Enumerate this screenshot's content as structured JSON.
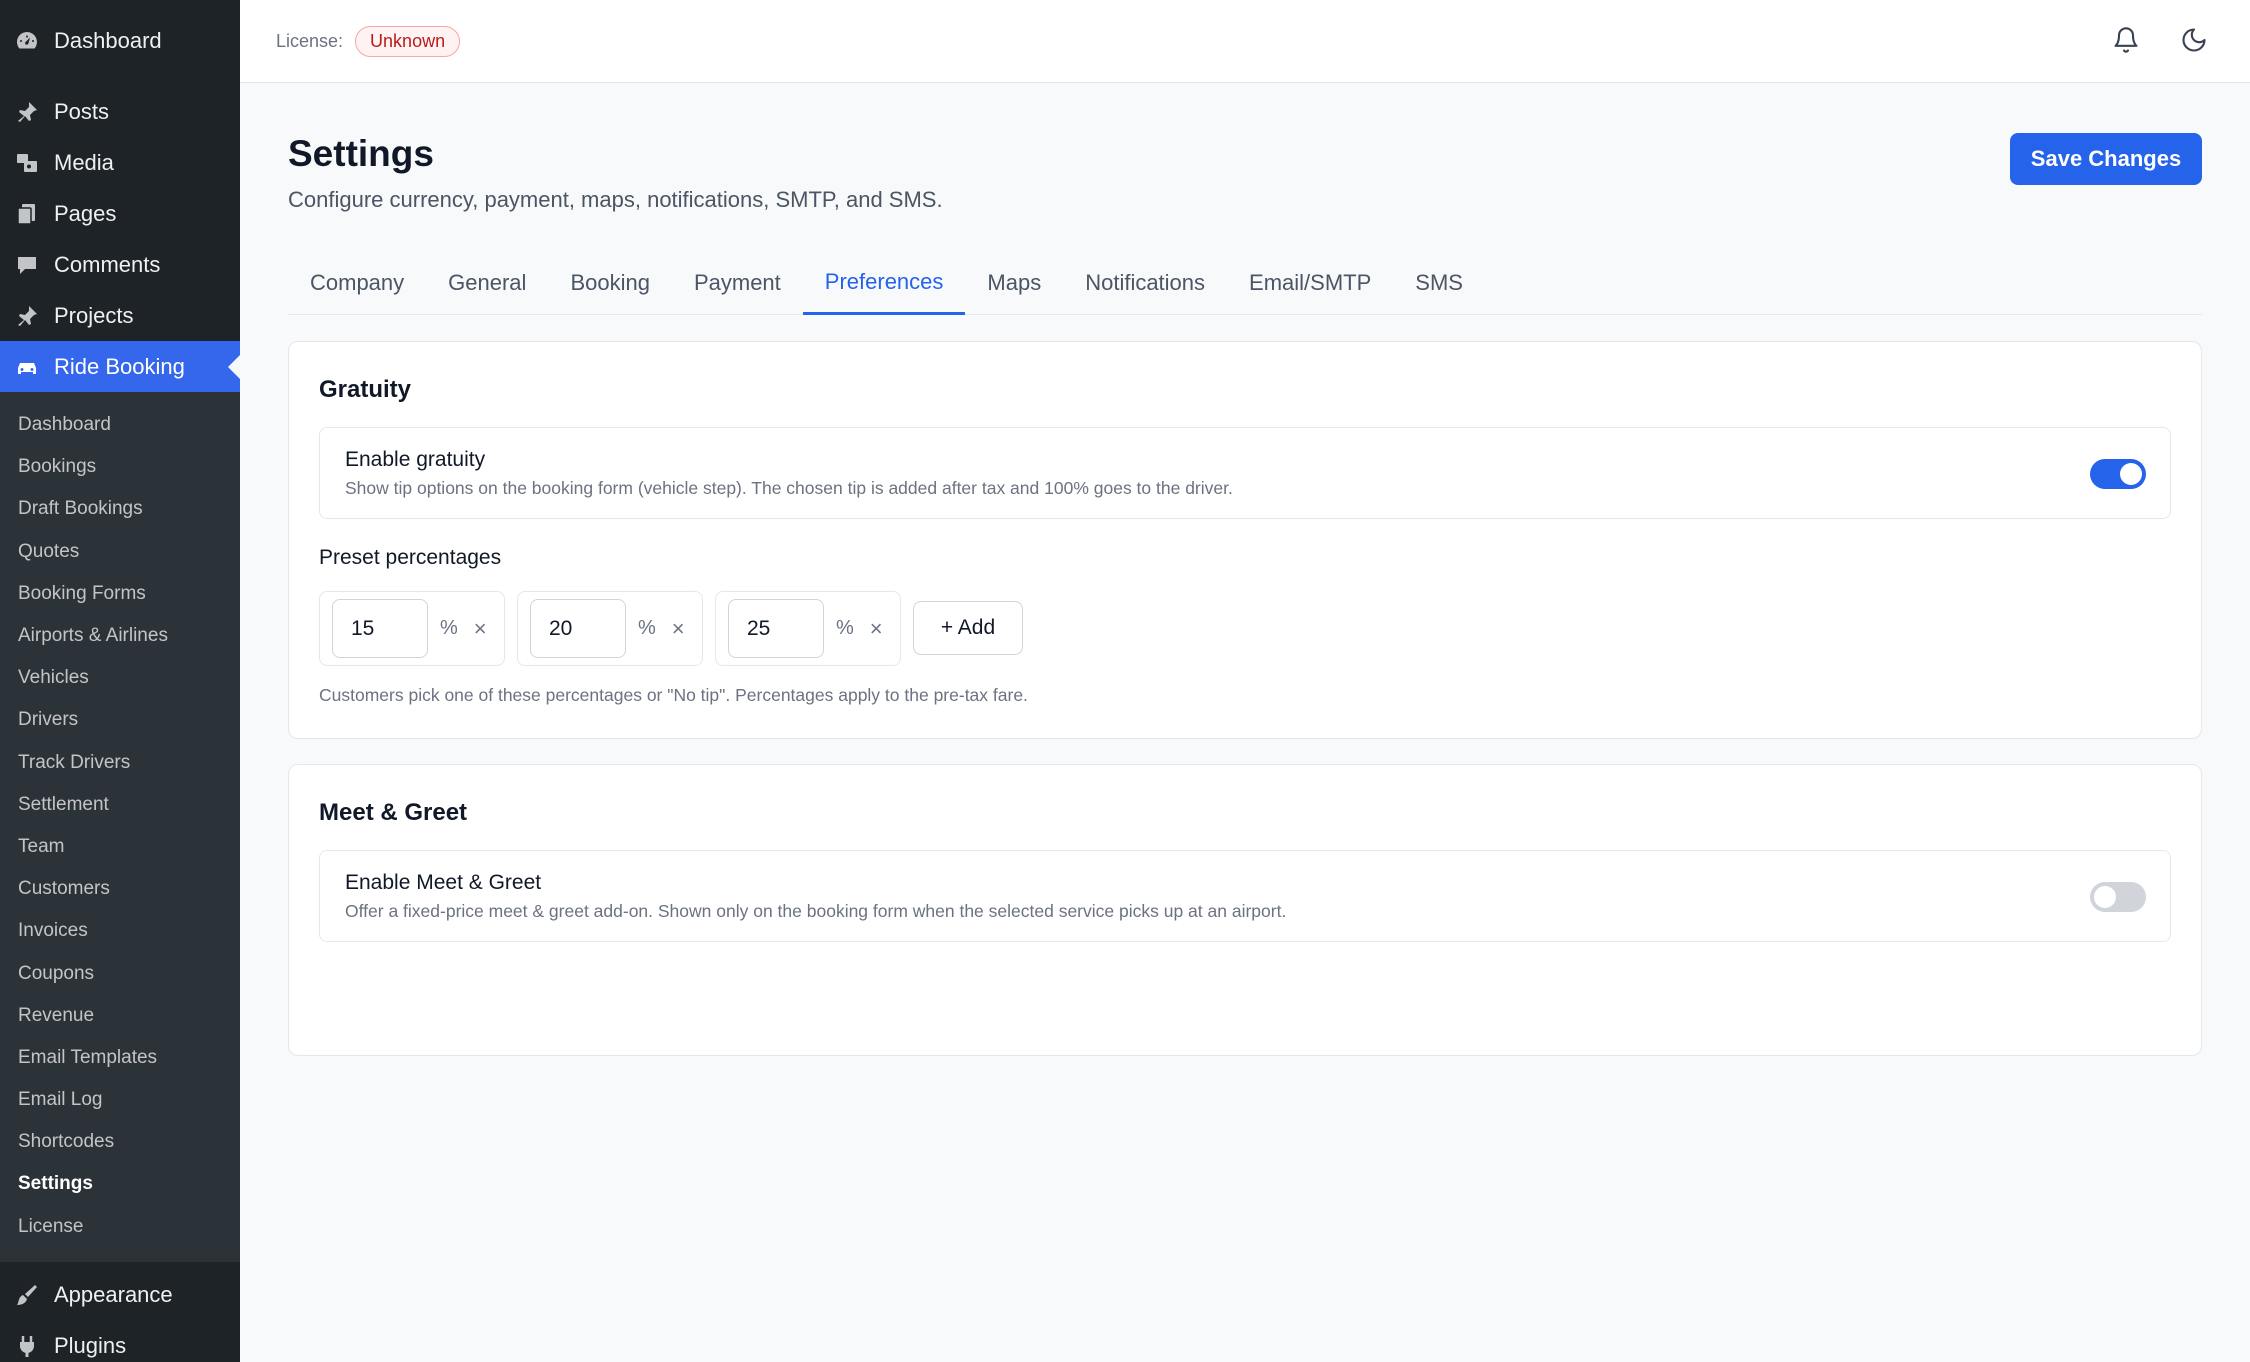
{
  "sidebar": {
    "top": [
      {
        "label": "Dashboard",
        "icon": "dashboard-icon"
      },
      {
        "label": "Posts",
        "icon": "pin-icon"
      },
      {
        "label": "Media",
        "icon": "media-icon"
      },
      {
        "label": "Pages",
        "icon": "pages-icon"
      },
      {
        "label": "Comments",
        "icon": "comment-icon"
      },
      {
        "label": "Projects",
        "icon": "pin-icon"
      },
      {
        "label": "Ride Booking",
        "icon": "car-icon"
      }
    ],
    "submenu": [
      "Dashboard",
      "Bookings",
      "Draft Bookings",
      "Quotes",
      "Booking Forms",
      "Airports & Airlines",
      "Vehicles",
      "Drivers",
      "Track Drivers",
      "Settlement",
      "Team",
      "Customers",
      "Invoices",
      "Coupons",
      "Revenue",
      "Email Templates",
      "Email Log",
      "Shortcodes",
      "Settings",
      "License"
    ],
    "bottom": [
      {
        "label": "Appearance",
        "icon": "brush-icon"
      },
      {
        "label": "Plugins",
        "icon": "plugin-icon"
      }
    ]
  },
  "topbar": {
    "license_label": "License:",
    "license_status": "Unknown"
  },
  "header": {
    "title": "Settings",
    "subtitle": "Configure currency, payment, maps, notifications, SMTP, and SMS.",
    "save_label": "Save Changes"
  },
  "tabs": [
    "Company",
    "General",
    "Booking",
    "Payment",
    "Preferences",
    "Maps",
    "Notifications",
    "Email/SMTP",
    "SMS"
  ],
  "active_tab": "Preferences",
  "gratuity": {
    "title": "Gratuity",
    "enable_title": "Enable gratuity",
    "enable_desc": "Show tip options on the booking form (vehicle step). The chosen tip is added after tax and 100% goes to the driver.",
    "enabled": true,
    "preset_label": "Preset percentages",
    "presets": [
      "15",
      "20",
      "25"
    ],
    "percent_symbol": "%",
    "remove_symbol": "×",
    "add_label": "+ Add",
    "note": "Customers pick one of these percentages or \"No tip\". Percentages apply to the pre-tax fare."
  },
  "meet_greet": {
    "title": "Meet & Greet",
    "enable_title": "Enable Meet & Greet",
    "enable_desc": "Offer a fixed-price meet & greet add-on. Shown only on the booking form when the selected service picks up at an airport.",
    "enabled": false
  },
  "colors": {
    "accent": "#2563eb",
    "sidebar_bg": "#1d2327",
    "danger": "#b91c1c"
  }
}
